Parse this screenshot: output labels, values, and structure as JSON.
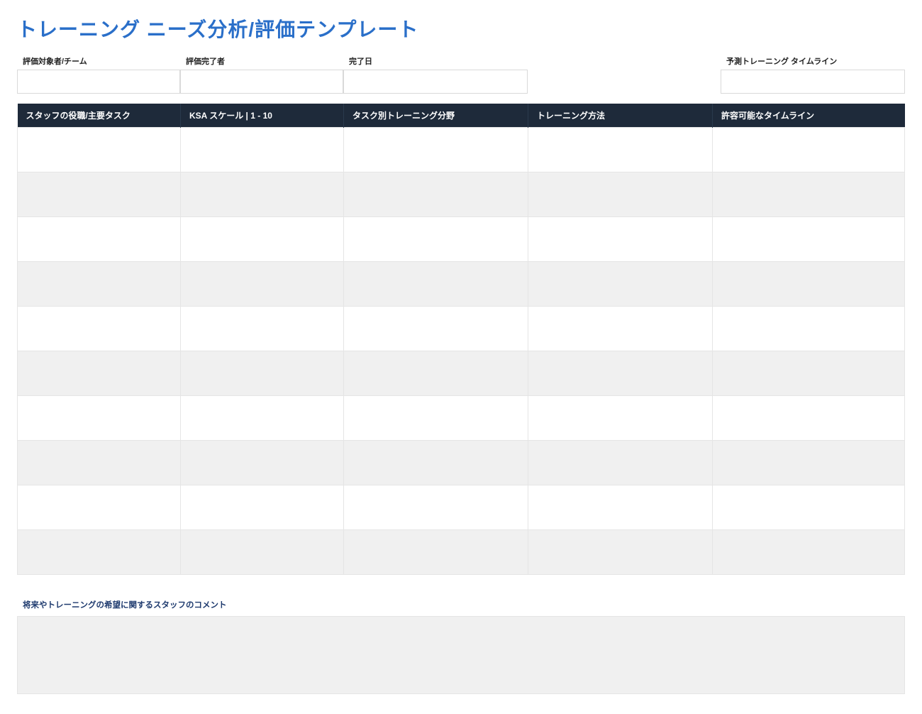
{
  "title": "トレーニング ニーズ分析/評価テンプレート",
  "meta": {
    "subject_label": "評価対象者/チーム",
    "subject_value": "",
    "completed_by_label": "評価完了者",
    "completed_by_value": "",
    "completion_date_label": "完了日",
    "completion_date_value": "",
    "timeline_label": "予測トレーニング タイムライン",
    "timeline_value": ""
  },
  "table": {
    "headers": {
      "role": "スタッフの役職/主要タスク",
      "ksa": "KSA スケール  |  1 - 10",
      "area": "タスク別トレーニング分野",
      "method": "トレーニング方法",
      "timeline": "許容可能なタイムライン"
    },
    "rows": [
      {
        "role": "",
        "ksa": "",
        "area": "",
        "method": "",
        "timeline": ""
      },
      {
        "role": "",
        "ksa": "",
        "area": "",
        "method": "",
        "timeline": ""
      },
      {
        "role": "",
        "ksa": "",
        "area": "",
        "method": "",
        "timeline": ""
      },
      {
        "role": "",
        "ksa": "",
        "area": "",
        "method": "",
        "timeline": ""
      },
      {
        "role": "",
        "ksa": "",
        "area": "",
        "method": "",
        "timeline": ""
      },
      {
        "role": "",
        "ksa": "",
        "area": "",
        "method": "",
        "timeline": ""
      },
      {
        "role": "",
        "ksa": "",
        "area": "",
        "method": "",
        "timeline": ""
      },
      {
        "role": "",
        "ksa": "",
        "area": "",
        "method": "",
        "timeline": ""
      },
      {
        "role": "",
        "ksa": "",
        "area": "",
        "method": "",
        "timeline": ""
      },
      {
        "role": "",
        "ksa": "",
        "area": "",
        "method": "",
        "timeline": ""
      }
    ]
  },
  "comments": {
    "label": "将来やトレーニングの希望に関するスタッフのコメント",
    "value": ""
  }
}
